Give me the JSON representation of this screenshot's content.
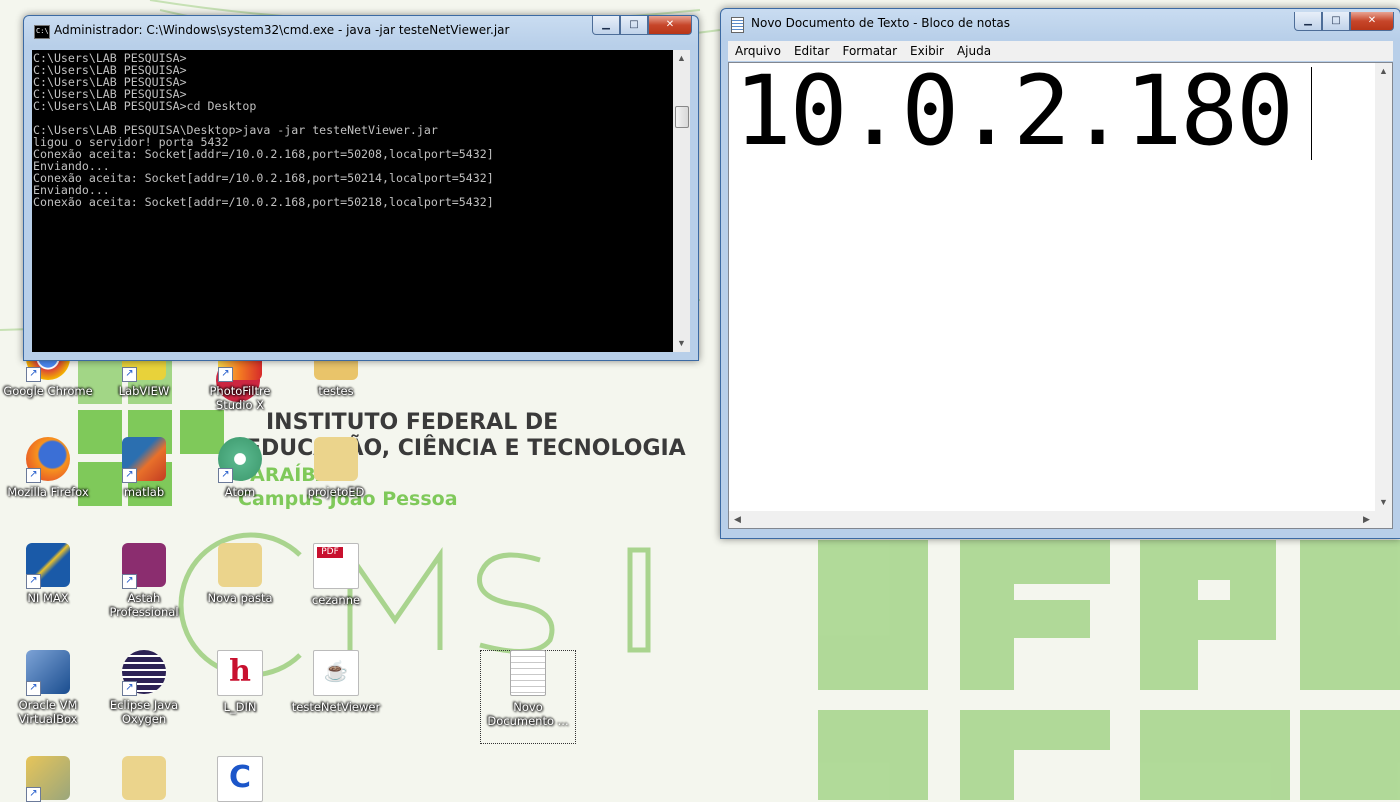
{
  "wallpaper": {
    "institution_line1": "INSTITUTO FEDERAL DE",
    "institution_line2": "EDUCAÇÃO, CIÊNCIA E TECNOLOGIA",
    "state": "PARAÍBA",
    "campus": "Campus João Pessoa",
    "letters": "C M S I",
    "side_letters": "IFPB",
    "colors": {
      "green": "#7fc95a",
      "dark_text": "#3a3a3a"
    }
  },
  "desktop_icons": [
    {
      "label": "Google Chrome",
      "icon": "chrome-icon"
    },
    {
      "label": "LabVIEW",
      "icon": "labview-icon"
    },
    {
      "label": "PhotoFiltre Studio X",
      "icon": "photofiltre-icon"
    },
    {
      "label": "testes",
      "icon": "folder-icon"
    },
    {
      "label": "Mozilla Firefox",
      "icon": "firefox-icon"
    },
    {
      "label": "matlab",
      "icon": "matlab-icon"
    },
    {
      "label": "Atom",
      "icon": "atom-icon"
    },
    {
      "label": "projetoED",
      "icon": "folder-icon"
    },
    {
      "label": "NI MAX",
      "icon": "nimax-icon"
    },
    {
      "label": "Astah Professional",
      "icon": "astah-icon"
    },
    {
      "label": "Nova pasta",
      "icon": "folder-icon"
    },
    {
      "label": "cezanne",
      "icon": "pdf-icon"
    },
    {
      "label": "Oracle VM VirtualBox",
      "icon": "virtualbox-icon"
    },
    {
      "label": "Eclipse Java Oxygen",
      "icon": "eclipse-icon"
    },
    {
      "label": "L_DIN",
      "icon": "h-file-icon"
    },
    {
      "label": "testeNetViewer",
      "icon": "jar-file-icon"
    },
    {
      "label": "Novo Documento ...",
      "icon": "text-file-icon"
    }
  ],
  "cmd": {
    "title": "Administrador: C:\\Windows\\system32\\cmd.exe - java  -jar testeNetViewer.jar",
    "lines": [
      "C:\\Users\\LAB PESQUISA>",
      "C:\\Users\\LAB PESQUISA>",
      "C:\\Users\\LAB PESQUISA>",
      "C:\\Users\\LAB PESQUISA>",
      "C:\\Users\\LAB PESQUISA>cd Desktop",
      "",
      "C:\\Users\\LAB PESQUISA\\Desktop>java -jar testeNetViewer.jar",
      "ligou o servidor! porta 5432",
      "Conexão aceita: Socket[addr=/10.0.2.168,port=50208,localport=5432]",
      "Enviando...",
      "Conexão aceita: Socket[addr=/10.0.2.168,port=50214,localport=5432]",
      "Enviando...",
      "Conexão aceita: Socket[addr=/10.0.2.168,port=50218,localport=5432]"
    ]
  },
  "notepad": {
    "title": "Novo Documento de Texto - Bloco de notas",
    "menu": [
      "Arquivo",
      "Editar",
      "Formatar",
      "Exibir",
      "Ajuda"
    ],
    "content": "10.0.2.180"
  },
  "window_controls": {
    "minimize": "▁",
    "maximize": "□",
    "close": "✕"
  }
}
